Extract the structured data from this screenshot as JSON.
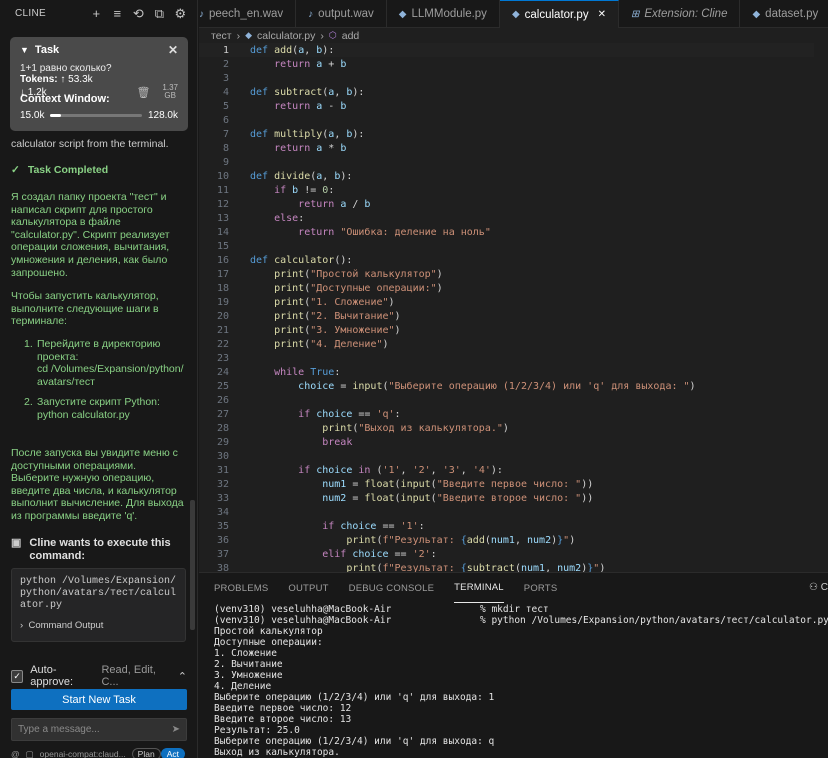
{
  "sidebar": {
    "title": "CLINE",
    "header_icons": [
      "plus-icon",
      "stack-icon",
      "history-icon",
      "external-icon",
      "gear-icon"
    ],
    "task": {
      "label": "Task",
      "question": "1+1 равно сколько?",
      "tokens_label": "Tokens:",
      "tokens_up": "↑ 53.3k",
      "tokens_down": "↓ 1.2k",
      "size_value": "1.37",
      "size_unit": "GB",
      "context_label": "Context Window:",
      "context_used": "15.0k",
      "context_max": "128.0k",
      "context_fraction": 0.117
    },
    "partial_text": "calculator script from the terminal.",
    "task_completed": "Task Completed",
    "completion_text": "Я создал папку проекта \"тест\" и написал скрипт для простого калькулятора в файле \"calculator.py\". Скрипт реализует операции сложения, вычитания, умножения и деления, как было запрошено.",
    "run_intro": "Чтобы запустить калькулятор, выполните следующие шаги в терминале:",
    "steps": [
      {
        "n": "1.",
        "text": "Перейдите в директорию проекта:",
        "cmd": "cd /Volumes/Expansion/python/avatars/тест"
      },
      {
        "n": "2.",
        "text": "Запустите скрипт Python:",
        "cmd": "python calculator.py"
      }
    ],
    "after_text": "После запуска вы увидите меню с доступными операциями. Выберите нужную операцию, введите два числа, и калькулятор выполнит вычисление. Для выхода из программы введите 'q'.",
    "exec_title": "Cline wants to execute this command:",
    "command": "python /Volumes/Expansion/python/avatars/тест/calculator.py",
    "command_output": "Command Output",
    "auto_approve_label": "Auto-approve:",
    "auto_approve_value": "Read, Edit, C...",
    "new_task": "Start New Task",
    "input_placeholder": "Type a message...",
    "model": "openai-compat:claud...",
    "plan": "Plan",
    "act": "Act"
  },
  "editor": {
    "tabs": [
      {
        "label": "peech_en.wav",
        "icon": "audio-icon",
        "active": false,
        "italic": false
      },
      {
        "label": "output.wav",
        "icon": "audio-icon",
        "active": false,
        "italic": false
      },
      {
        "label": "LLMModule.py",
        "icon": "python-icon",
        "active": false,
        "italic": false
      },
      {
        "label": "calculator.py",
        "icon": "python-icon",
        "active": true,
        "italic": false
      },
      {
        "label": "Extension: Cline",
        "icon": "extension-icon",
        "active": false,
        "italic": true
      },
      {
        "label": "dataset.py",
        "icon": "python-icon",
        "active": false,
        "italic": false
      }
    ],
    "breadcrumbs": [
      "тест",
      "calculator.py",
      "add"
    ],
    "current_line": 1,
    "code": [
      [
        [
          "kw",
          "def "
        ],
        [
          "fn",
          "add"
        ],
        [
          "op",
          "("
        ],
        [
          "vr",
          "a"
        ],
        [
          "op",
          ", "
        ],
        [
          "vr",
          "b"
        ],
        [
          "op",
          "):"
        ]
      ],
      [
        [
          "op",
          "    "
        ],
        [
          "ck",
          "return "
        ],
        [
          "vr",
          "a"
        ],
        [
          "op",
          " + "
        ],
        [
          "vr",
          "b"
        ]
      ],
      [],
      [
        [
          "kw",
          "def "
        ],
        [
          "fn",
          "subtract"
        ],
        [
          "op",
          "("
        ],
        [
          "vr",
          "a"
        ],
        [
          "op",
          ", "
        ],
        [
          "vr",
          "b"
        ],
        [
          "op",
          "):"
        ]
      ],
      [
        [
          "op",
          "    "
        ],
        [
          "ck",
          "return "
        ],
        [
          "vr",
          "a"
        ],
        [
          "op",
          " - "
        ],
        [
          "vr",
          "b"
        ]
      ],
      [],
      [
        [
          "kw",
          "def "
        ],
        [
          "fn",
          "multiply"
        ],
        [
          "op",
          "("
        ],
        [
          "vr",
          "a"
        ],
        [
          "op",
          ", "
        ],
        [
          "vr",
          "b"
        ],
        [
          "op",
          "):"
        ]
      ],
      [
        [
          "op",
          "    "
        ],
        [
          "ck",
          "return "
        ],
        [
          "vr",
          "a"
        ],
        [
          "op",
          " * "
        ],
        [
          "vr",
          "b"
        ]
      ],
      [],
      [
        [
          "kw",
          "def "
        ],
        [
          "fn",
          "divide"
        ],
        [
          "op",
          "("
        ],
        [
          "vr",
          "a"
        ],
        [
          "op",
          ", "
        ],
        [
          "vr",
          "b"
        ],
        [
          "op",
          "):"
        ]
      ],
      [
        [
          "op",
          "    "
        ],
        [
          "ck",
          "if "
        ],
        [
          "vr",
          "b"
        ],
        [
          "op",
          " != "
        ],
        [
          "nu",
          "0"
        ],
        [
          "op",
          ":"
        ]
      ],
      [
        [
          "op",
          "        "
        ],
        [
          "ck",
          "return "
        ],
        [
          "vr",
          "a"
        ],
        [
          "op",
          " / "
        ],
        [
          "vr",
          "b"
        ]
      ],
      [
        [
          "op",
          "    "
        ],
        [
          "ck",
          "else"
        ],
        [
          "op",
          ":"
        ]
      ],
      [
        [
          "op",
          "        "
        ],
        [
          "ck",
          "return "
        ],
        [
          "st",
          "\"Ошибка: деление на ноль\""
        ]
      ],
      [],
      [
        [
          "kw",
          "def "
        ],
        [
          "fn",
          "calculator"
        ],
        [
          "op",
          "():"
        ]
      ],
      [
        [
          "op",
          "    "
        ],
        [
          "fn",
          "print"
        ],
        [
          "op",
          "("
        ],
        [
          "st",
          "\"Простой калькулятор\""
        ],
        [
          "op",
          ")"
        ]
      ],
      [
        [
          "op",
          "    "
        ],
        [
          "fn",
          "print"
        ],
        [
          "op",
          "("
        ],
        [
          "st",
          "\"Доступные операции:\""
        ],
        [
          "op",
          ")"
        ]
      ],
      [
        [
          "op",
          "    "
        ],
        [
          "fn",
          "print"
        ],
        [
          "op",
          "("
        ],
        [
          "st",
          "\"1. Сложение\""
        ],
        [
          "op",
          ")"
        ]
      ],
      [
        [
          "op",
          "    "
        ],
        [
          "fn",
          "print"
        ],
        [
          "op",
          "("
        ],
        [
          "st",
          "\"2. Вычитание\""
        ],
        [
          "op",
          ")"
        ]
      ],
      [
        [
          "op",
          "    "
        ],
        [
          "fn",
          "print"
        ],
        [
          "op",
          "("
        ],
        [
          "st",
          "\"3. Умножение\""
        ],
        [
          "op",
          ")"
        ]
      ],
      [
        [
          "op",
          "    "
        ],
        [
          "fn",
          "print"
        ],
        [
          "op",
          "("
        ],
        [
          "st",
          "\"4. Деление\""
        ],
        [
          "op",
          ")"
        ]
      ],
      [],
      [
        [
          "op",
          "    "
        ],
        [
          "ck",
          "while "
        ],
        [
          "kw",
          "True"
        ],
        [
          "op",
          ":"
        ]
      ],
      [
        [
          "op",
          "        "
        ],
        [
          "vr",
          "choice"
        ],
        [
          "op",
          " = "
        ],
        [
          "fn",
          "input"
        ],
        [
          "op",
          "("
        ],
        [
          "st",
          "\"Выберите операцию (1/2/3/4) или 'q' для выхода: \""
        ],
        [
          "op",
          ")"
        ]
      ],
      [],
      [
        [
          "op",
          "        "
        ],
        [
          "ck",
          "if "
        ],
        [
          "vr",
          "choice"
        ],
        [
          "op",
          " == "
        ],
        [
          "st",
          "'q'"
        ],
        [
          "op",
          ":"
        ]
      ],
      [
        [
          "op",
          "            "
        ],
        [
          "fn",
          "print"
        ],
        [
          "op",
          "("
        ],
        [
          "st",
          "\"Выход из калькулятора.\""
        ],
        [
          "op",
          ")"
        ]
      ],
      [
        [
          "op",
          "            "
        ],
        [
          "ck",
          "break"
        ]
      ],
      [],
      [
        [
          "op",
          "        "
        ],
        [
          "ck",
          "if "
        ],
        [
          "vr",
          "choice"
        ],
        [
          "ck",
          " in "
        ],
        [
          "op",
          "("
        ],
        [
          "st",
          "'1'"
        ],
        [
          "op",
          ", "
        ],
        [
          "st",
          "'2'"
        ],
        [
          "op",
          ", "
        ],
        [
          "st",
          "'3'"
        ],
        [
          "op",
          ", "
        ],
        [
          "st",
          "'4'"
        ],
        [
          "op",
          "):"
        ]
      ],
      [
        [
          "op",
          "            "
        ],
        [
          "vr",
          "num1"
        ],
        [
          "op",
          " = "
        ],
        [
          "fn",
          "float"
        ],
        [
          "op",
          "("
        ],
        [
          "fn",
          "input"
        ],
        [
          "op",
          "("
        ],
        [
          "st",
          "\"Введите первое число: \""
        ],
        [
          "op",
          "))"
        ]
      ],
      [
        [
          "op",
          "            "
        ],
        [
          "vr",
          "num2"
        ],
        [
          "op",
          " = "
        ],
        [
          "fn",
          "float"
        ],
        [
          "op",
          "("
        ],
        [
          "fn",
          "input"
        ],
        [
          "op",
          "("
        ],
        [
          "st",
          "\"Введите второе число: \""
        ],
        [
          "op",
          "))"
        ]
      ],
      [],
      [
        [
          "op",
          "            "
        ],
        [
          "ck",
          "if "
        ],
        [
          "vr",
          "choice"
        ],
        [
          "op",
          " == "
        ],
        [
          "st",
          "'1'"
        ],
        [
          "op",
          ":"
        ]
      ],
      [
        [
          "op",
          "                "
        ],
        [
          "fn",
          "print"
        ],
        [
          "op",
          "("
        ],
        [
          "st",
          "f\"Результат: "
        ],
        [
          "kw",
          "{"
        ],
        [
          "fn",
          "add"
        ],
        [
          "op",
          "("
        ],
        [
          "vr",
          "num1"
        ],
        [
          "op",
          ", "
        ],
        [
          "vr",
          "num2"
        ],
        [
          "op",
          ")"
        ],
        [
          "kw",
          "}"
        ],
        [
          "st",
          "\""
        ],
        [
          "op",
          ")"
        ]
      ],
      [
        [
          "op",
          "            "
        ],
        [
          "ck",
          "elif "
        ],
        [
          "vr",
          "choice"
        ],
        [
          "op",
          " == "
        ],
        [
          "st",
          "'2'"
        ],
        [
          "op",
          ":"
        ]
      ],
      [
        [
          "op",
          "                "
        ],
        [
          "fn",
          "print"
        ],
        [
          "op",
          "("
        ],
        [
          "st",
          "f\"Результат: "
        ],
        [
          "kw",
          "{"
        ],
        [
          "fn",
          "subtract"
        ],
        [
          "op",
          "("
        ],
        [
          "vr",
          "num1"
        ],
        [
          "op",
          ", "
        ],
        [
          "vr",
          "num2"
        ],
        [
          "op",
          ")"
        ],
        [
          "kw",
          "}"
        ],
        [
          "st",
          "\""
        ],
        [
          "op",
          ")"
        ]
      ]
    ]
  },
  "panel": {
    "tabs": [
      {
        "label": "PROBLEMS",
        "active": false
      },
      {
        "label": "OUTPUT",
        "active": false
      },
      {
        "label": "DEBUG CONSOLE",
        "active": false
      },
      {
        "label": "TERMINAL",
        "active": true
      },
      {
        "label": "PORTS",
        "active": false
      }
    ],
    "right_label": "C",
    "terminal": [
      {
        "left": "(venv310) veseluhha@MacBook-Air",
        "right": "% mkdir тест"
      },
      {
        "left": "(venv310) veseluhha@MacBook-Air",
        "right": "% python /Volumes/Expansion/python/avatars/тест/calculator.py"
      },
      {
        "left": "Простой калькулятор",
        "right": ""
      },
      {
        "left": "Доступные операции:",
        "right": ""
      },
      {
        "left": "1. Сложение",
        "right": ""
      },
      {
        "left": "2. Вычитание",
        "right": ""
      },
      {
        "left": "3. Умножение",
        "right": ""
      },
      {
        "left": "4. Деление",
        "right": ""
      },
      {
        "left": "Выберите операцию (1/2/3/4) или 'q' для выхода: 1",
        "right": ""
      },
      {
        "left": "Введите первое число: 12",
        "right": ""
      },
      {
        "left": "Введите второе число: 13",
        "right": ""
      },
      {
        "left": "Результат: 25.0",
        "right": ""
      },
      {
        "left": "Выберите операцию (1/2/3/4) или 'q' для выхода: q",
        "right": ""
      },
      {
        "left": "Выход из калькулятора.",
        "right": ""
      }
    ]
  }
}
